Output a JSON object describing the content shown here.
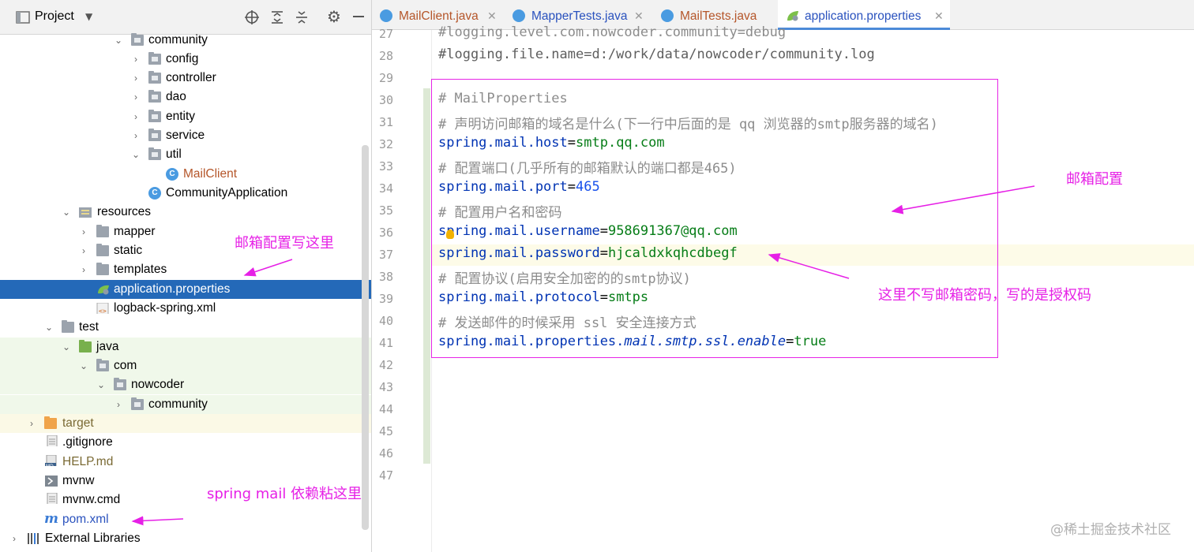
{
  "project_panel": {
    "title": "Project",
    "tree": [
      {
        "label": "community",
        "type": "package",
        "state": "expanded"
      },
      {
        "label": "config",
        "type": "package",
        "state": "collapsed"
      },
      {
        "label": "controller",
        "type": "package",
        "state": "collapsed"
      },
      {
        "label": "dao",
        "type": "package",
        "state": "collapsed"
      },
      {
        "label": "entity",
        "type": "package",
        "state": "collapsed"
      },
      {
        "label": "service",
        "type": "package",
        "state": "collapsed"
      },
      {
        "label": "util",
        "type": "package",
        "state": "expanded"
      },
      {
        "label": "MailClient",
        "type": "class"
      },
      {
        "label": "CommunityApplication",
        "type": "class"
      },
      {
        "label": "resources",
        "type": "resources-folder",
        "state": "expanded"
      },
      {
        "label": "mapper",
        "type": "folder",
        "state": "collapsed"
      },
      {
        "label": "static",
        "type": "folder",
        "state": "collapsed"
      },
      {
        "label": "templates",
        "type": "folder",
        "state": "collapsed"
      },
      {
        "label": "application.properties",
        "type": "properties-file",
        "selected": true
      },
      {
        "label": "logback-spring.xml",
        "type": "xml-file"
      },
      {
        "label": "test",
        "type": "folder",
        "state": "expanded"
      },
      {
        "label": "java",
        "type": "test-source-folder",
        "state": "expanded"
      },
      {
        "label": "com",
        "type": "package",
        "state": "expanded"
      },
      {
        "label": "nowcoder",
        "type": "package",
        "state": "expanded"
      },
      {
        "label": "community",
        "type": "package",
        "state": "collapsed"
      },
      {
        "label": "target",
        "type": "excluded-folder",
        "state": "collapsed"
      },
      {
        "label": ".gitignore",
        "type": "text-file"
      },
      {
        "label": "HELP.md",
        "type": "markdown-file"
      },
      {
        "label": "mvnw",
        "type": "script-file"
      },
      {
        "label": "mvnw.cmd",
        "type": "script-file"
      },
      {
        "label": "pom.xml",
        "type": "maven-file"
      },
      {
        "label": "External Libraries",
        "type": "libraries",
        "state": "collapsed"
      }
    ]
  },
  "tabs": [
    {
      "label": "MailClient.java"
    },
    {
      "label": "MapperTests.java"
    },
    {
      "label": "MailTests.java"
    },
    {
      "label": "application.properties",
      "active": true
    }
  ],
  "editor": {
    "line_numbers": [
      "27",
      "28",
      "29",
      "30",
      "31",
      "32",
      "33",
      "34",
      "35",
      "36",
      "37",
      "38",
      "39",
      "40",
      "41",
      "42",
      "43",
      "44",
      "45",
      "46",
      "47"
    ],
    "lines": {
      "l27": "#logging.level.com.nowcoder.community=debug",
      "l28": "#logging.file.name=d:/work/data/nowcoder/community.log",
      "l30": "# MailProperties",
      "l31": "# 声明访问邮箱的域名是什么(下一行中后面的是 qq 浏览器的smtp服务器的域名)",
      "l32_key": "spring.mail.host",
      "l32_val": "smtp.qq.com",
      "l33": "# 配置端口(几乎所有的邮箱默认的端口都是465)",
      "l34_key": "spring.mail.port",
      "l34_val": "465",
      "l35": "# 配置用户名和密码",
      "l36_key": "spring.mail.username",
      "l36_val": "958691367@qq.com",
      "l37_key": "spring.mail.password",
      "l37_val": "hjcaldxkqhcdbegf",
      "l38": "# 配置协议(启用安全加密的的smtp协议)",
      "l39_key": "spring.mail.protocol",
      "l39_val": "smtps",
      "l40": "# 发送邮件的时候采用 ssl 安全连接方式",
      "l41_key": "spring.mail.properties.",
      "l41_italic": "mail.smtp.ssl.enable",
      "l41_val": "true"
    },
    "eq": "="
  },
  "annotations": {
    "mail_config_here": "邮箱配置写这里",
    "mail_config": "邮箱配置",
    "auth_code_note": "这里不写邮箱密码，写的是授权码",
    "dependency_note": "spring mail 依赖粘这里"
  },
  "watermark": "@稀土掘金技术社区",
  "colors": {
    "annotation": "#e620e6",
    "selection": "#2469b8",
    "keyword": "#0033b3",
    "string": "#067d17",
    "number": "#1750eb",
    "comment": "#8c8c8c"
  }
}
